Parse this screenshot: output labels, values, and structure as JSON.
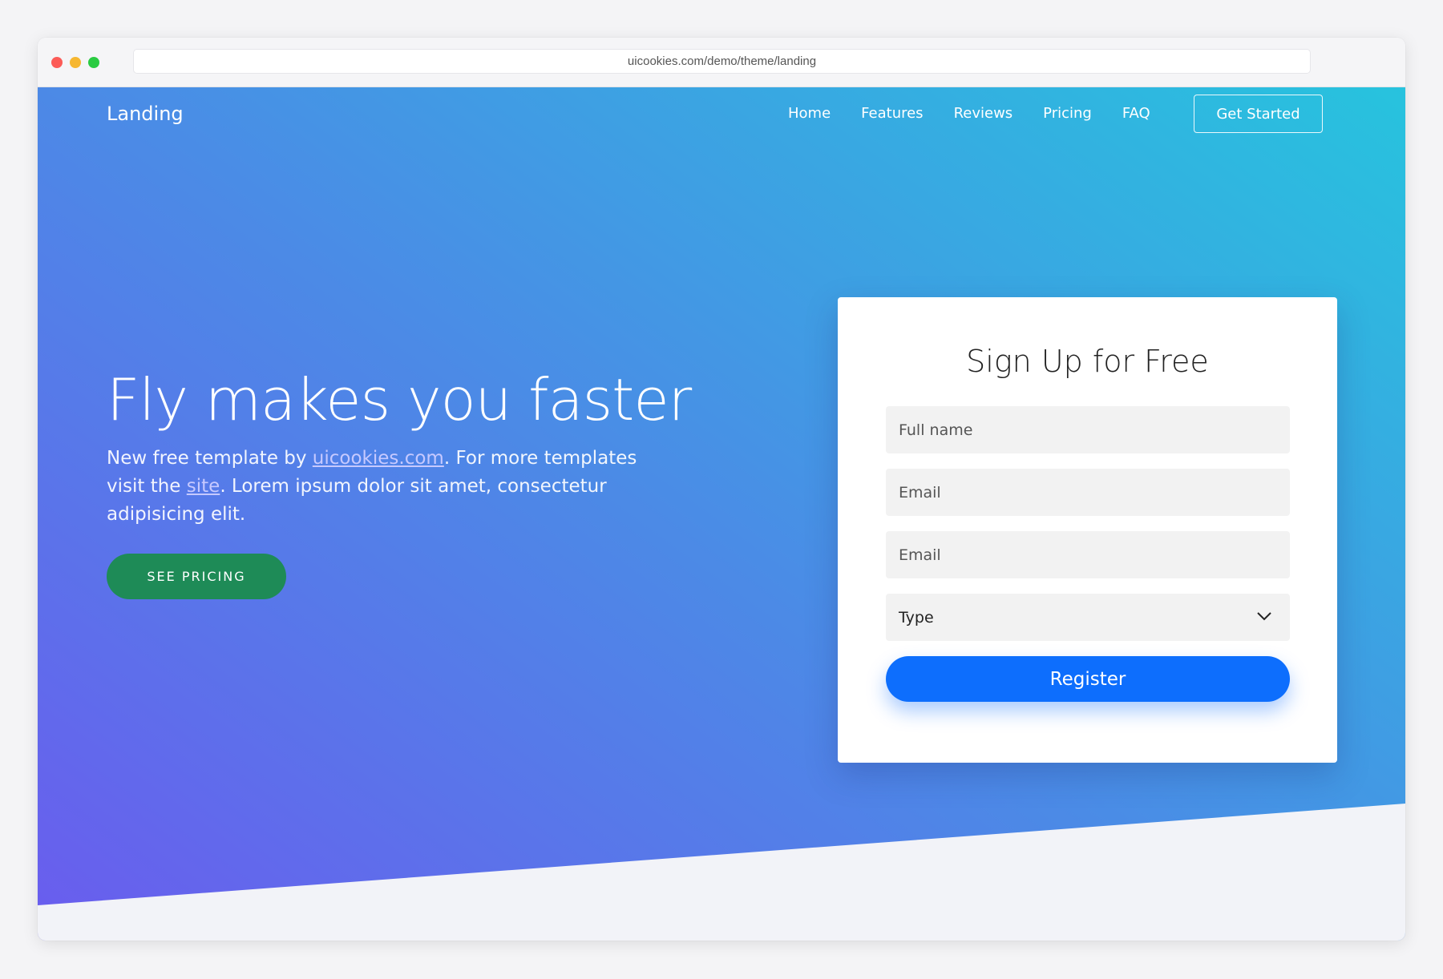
{
  "browser": {
    "url": "uicookies.com/demo/theme/landing"
  },
  "navbar": {
    "brand": "Landing",
    "links": [
      "Home",
      "Features",
      "Reviews",
      "Pricing",
      "FAQ"
    ],
    "cta_label": "Get Started"
  },
  "hero": {
    "headline": "Fly makes you faster",
    "lead_part1": "New free template by ",
    "lead_link1": "uicookies.com",
    "lead_part2": ". For more templates visit the ",
    "lead_link2": "site",
    "lead_part3": ". Lorem ipsum dolor sit amet, consectetur adipisicing elit.",
    "button_label": "SEE PRICING"
  },
  "signup": {
    "title": "Sign Up for Free",
    "full_name_placeholder": "Full name",
    "email_placeholder": "Email",
    "email2_placeholder": "Email",
    "type_label": "Type",
    "register_label": "Register"
  },
  "colors": {
    "gradient_start": "#6a5cee",
    "gradient_end": "#27c3de",
    "pricing_button": "#1e8b57",
    "register_button": "#0d6efd"
  }
}
